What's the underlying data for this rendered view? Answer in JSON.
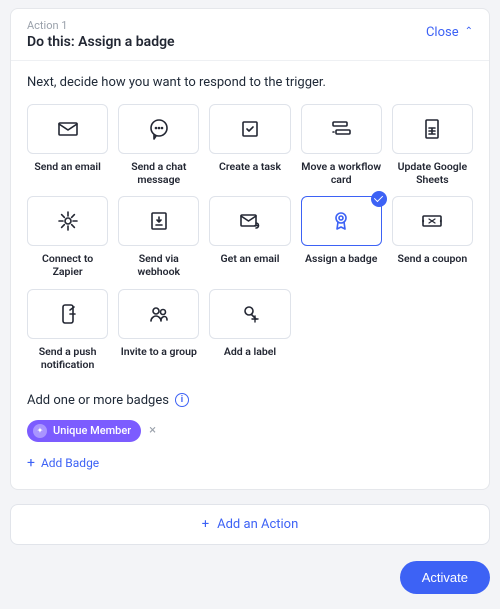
{
  "header": {
    "action_number": "Action 1",
    "title": "Do this: Assign a badge",
    "close": "Close"
  },
  "prompt": "Next, decide how you want to respond to the trigger.",
  "tiles": [
    {
      "id": "send-email",
      "label": "Send an email"
    },
    {
      "id": "send-chat",
      "label": "Send a chat message"
    },
    {
      "id": "create-task",
      "label": "Create a task"
    },
    {
      "id": "move-card",
      "label": "Move a workflow card"
    },
    {
      "id": "update-sheets",
      "label": "Update Google Sheets"
    },
    {
      "id": "connect-zapier",
      "label": "Connect to Zapier"
    },
    {
      "id": "send-webhook",
      "label": "Send via webhook"
    },
    {
      "id": "get-email",
      "label": "Get an email"
    },
    {
      "id": "assign-badge",
      "label": "Assign a badge",
      "selected": true
    },
    {
      "id": "send-coupon",
      "label": "Send a coupon"
    },
    {
      "id": "send-push",
      "label": "Send a push notification"
    },
    {
      "id": "invite-group",
      "label": "Invite to a group"
    },
    {
      "id": "add-label",
      "label": "Add a label"
    }
  ],
  "badges": {
    "section_label": "Add one or more badges",
    "items": [
      {
        "name": "Unique Member"
      }
    ],
    "add_label": "Add Badge"
  },
  "add_action": "Add an Action",
  "activate": "Activate"
}
